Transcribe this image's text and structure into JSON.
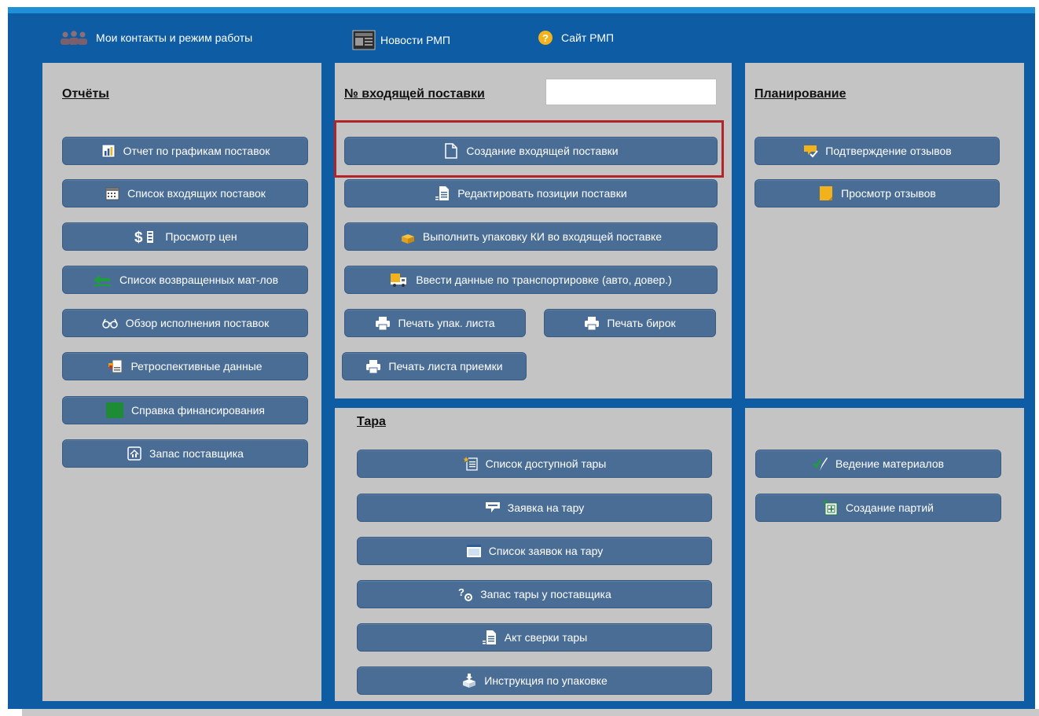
{
  "colors": {
    "frame_blue": "#0e5ca3",
    "panel_grey": "#c4c4c4",
    "button_blue": "#4a6d96",
    "highlight_red": "#b3242a"
  },
  "top_links": {
    "contacts": {
      "label": "Мои контакты и режим работы",
      "icon": "people-icon"
    },
    "news": {
      "label": "Новости РМП",
      "icon": "newspaper-icon"
    },
    "site": {
      "label": "Сайт РМП",
      "icon": "help-circle-icon"
    }
  },
  "reports": {
    "title": "Отчёты",
    "buttons": [
      {
        "label": "Отчет по графикам поставок",
        "icon": "chart-icon"
      },
      {
        "label": "Список входящих поставок",
        "icon": "calendar-icon"
      },
      {
        "label": "Просмотр цен",
        "icon": "dollar-icon"
      },
      {
        "label": "Список возвращенных мат-лов",
        "icon": "return-arrow-icon"
      },
      {
        "label": "Обзор исполнения поставок",
        "icon": "glasses-icon"
      },
      {
        "label": "Ретроспективные данные",
        "icon": "history-doc-icon"
      },
      {
        "label": "Справка финансирования",
        "icon": "green-square-icon"
      },
      {
        "label": "Запас поставщика",
        "icon": "stock-icon"
      }
    ]
  },
  "delivery": {
    "label": "№ входящей поставки",
    "input_value": "",
    "create": {
      "label": "Создание входящей поставки",
      "icon": "document-icon"
    },
    "edit": {
      "label": "Редактировать позиции поставки",
      "icon": "edit-doc-icon"
    },
    "pack": {
      "label": "Выполнить упаковку КИ во входящей поставке",
      "icon": "package-icon"
    },
    "transport": {
      "label": "Ввести данные по транспортировке (авто, довер.)",
      "icon": "truck-icon"
    },
    "print_pack_list": {
      "label": "Печать упак. листа",
      "icon": "printer-icon"
    },
    "print_tags": {
      "label": "Печать бирок",
      "icon": "printer-icon"
    },
    "print_acceptance": {
      "label": "Печать листа приемки",
      "icon": "printer-icon"
    }
  },
  "planning": {
    "title": "Планирование",
    "buttons": [
      {
        "label": "Подтверждение отзывов",
        "icon": "feedback-confirm-icon"
      },
      {
        "label": "Просмотр отзывов",
        "icon": "note-icon"
      }
    ]
  },
  "tara": {
    "title": "Тара",
    "buttons": [
      {
        "label": "Список доступной тары",
        "icon": "list-star-icon"
      },
      {
        "label": "Заявка на тару",
        "icon": "speech-bubble-icon"
      },
      {
        "label": "Список заявок на тару",
        "icon": "window-icon"
      },
      {
        "label": "Запас тары у поставщика",
        "icon": "question-gear-icon"
      },
      {
        "label": "Акт сверки тары",
        "icon": "edit-doc-icon"
      },
      {
        "label": "Инструкция по упаковке",
        "icon": "box-instruction-icon"
      }
    ]
  },
  "materials": {
    "buttons": [
      {
        "label": "Ведение материалов",
        "icon": "check-pen-icon"
      },
      {
        "label": "Создание партий",
        "icon": "create-batch-icon"
      }
    ]
  }
}
